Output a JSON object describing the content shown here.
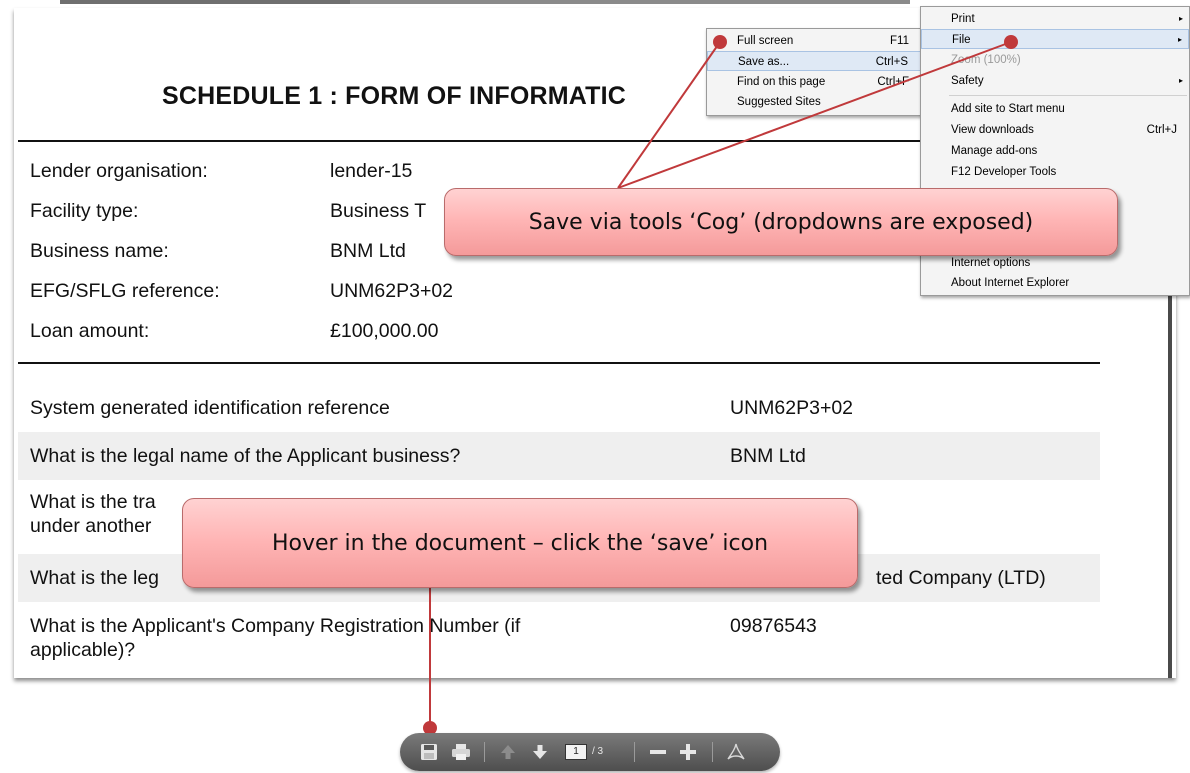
{
  "document": {
    "title": "SCHEDULE 1 : FORM OF INFORMATIC",
    "info": [
      {
        "label": "Lender organisation:",
        "value": "lender-15"
      },
      {
        "label": "Facility type:",
        "value": "Business T"
      },
      {
        "label": "Business name:",
        "value": "BNM Ltd"
      },
      {
        "label": "EFG/SFLG reference:",
        "value": "UNM62P3+02"
      },
      {
        "label": "Loan amount:",
        "value": "£100,000.00"
      }
    ],
    "questions": [
      {
        "q1": "System generated identification reference",
        "q2": "",
        "a": "UNM62P3+02"
      },
      {
        "q1": "What is the legal name of the Applicant business?",
        "q2": "",
        "a": "BNM Ltd"
      },
      {
        "q1": "What is the tra",
        "q2": "under another",
        "a": ""
      },
      {
        "q1": "What is the leg",
        "q2": "",
        "a": "ted Company (LTD)"
      },
      {
        "q1": "What is the Applicant's Company Registration Number (if",
        "q2": "applicable)?",
        "a": "09876543"
      }
    ]
  },
  "file_submenu": {
    "items": [
      {
        "label": "Full screen",
        "shortcut": "F11"
      },
      {
        "label": "Save as...",
        "shortcut": "Ctrl+S"
      },
      {
        "label": "Find on this page",
        "shortcut": "Ctrl+F"
      },
      {
        "label": "Suggested Sites",
        "shortcut": ""
      }
    ]
  },
  "tools_menu": {
    "items": [
      {
        "label": "Print",
        "shortcut": "",
        "arrow": "▸"
      },
      {
        "label": "File",
        "shortcut": "",
        "arrow": "▸"
      },
      {
        "label": "Zoom (100%)",
        "shortcut": "",
        "arrow": ""
      },
      {
        "label": "Safety",
        "shortcut": "",
        "arrow": "▸"
      },
      {
        "label": "Add site to Start menu",
        "shortcut": "",
        "arrow": ""
      },
      {
        "label": "View downloads",
        "shortcut": "Ctrl+J",
        "arrow": ""
      },
      {
        "label": "Manage add-ons",
        "shortcut": "",
        "arrow": ""
      },
      {
        "label": "F12 Developer Tools",
        "shortcut": "",
        "arrow": ""
      },
      {
        "label": "Internet options",
        "shortcut": "",
        "arrow": ""
      },
      {
        "label": "About Internet Explorer",
        "shortcut": "",
        "arrow": ""
      }
    ]
  },
  "callouts": {
    "cog": "Save via tools ‘Cog’ (dropdowns are exposed)",
    "save_icon": "Hover in the document – click the ‘save’ icon"
  },
  "pdf_toolbar": {
    "page_current": "1",
    "page_total": "/ 3",
    "icons": [
      "save-icon",
      "print-icon",
      "previous-page-icon",
      "next-page-icon",
      "zoom-out-icon",
      "zoom-in-icon",
      "acrobat-icon"
    ]
  },
  "colors": {
    "callout_fill": "#ffb6b6",
    "callout_border": "#b96b6b",
    "pointer": "#c0393b",
    "menu_highlight": "#dfe9f5",
    "toolbar": "#5e5e5e"
  }
}
